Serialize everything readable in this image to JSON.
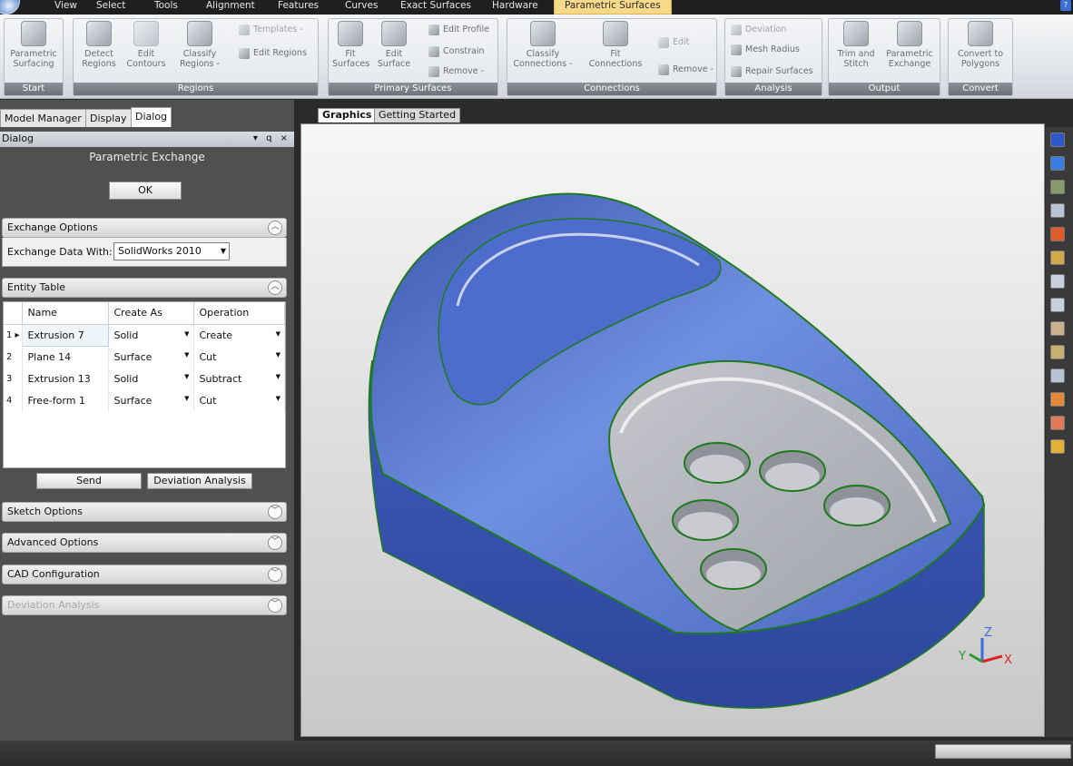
{
  "menubar": {
    "tabs": [
      "View",
      "Select",
      "Tools",
      "Alignment",
      "Features",
      "Curves",
      "Exact Surfaces",
      "Hardware",
      "Parametric Surfaces"
    ],
    "active_tab": "Parametric Surfaces"
  },
  "ribbon": {
    "groups": {
      "start": "Start",
      "regions": "Regions",
      "primary": "Primary Surfaces",
      "connections": "Connections",
      "analysis": "Analysis",
      "output": "Output",
      "convert": "Convert"
    },
    "buttons": {
      "parametric_surfacing": [
        "Parametric",
        "Surfacing"
      ],
      "detect_regions": [
        "Detect",
        "Regions"
      ],
      "edit_contours": [
        "Edit",
        "Contours"
      ],
      "classify_regions": [
        "Classify",
        "Regions -"
      ],
      "templates": "Templates -",
      "edit_regions": "Edit Regions",
      "fit_surfaces": [
        "Fit",
        "Surfaces"
      ],
      "edit_surface": [
        "Edit",
        "Surface"
      ],
      "edit_profile": "Edit Profile",
      "constrain": "Constrain",
      "remove_surf": "Remove -",
      "classify_connections": [
        "Classify",
        "Connections -"
      ],
      "fit_connections": [
        "Fit",
        "Connections"
      ],
      "edit_conn": "Edit",
      "remove_conn": "Remove -",
      "deviation": "Deviation",
      "mesh_radius": "Mesh Radius",
      "repair_surfaces": "Repair Surfaces",
      "trim_stitch": [
        "Trim and",
        "Stitch"
      ],
      "parametric_exchange": [
        "Parametric",
        "Exchange"
      ],
      "convert_polygons": [
        "Convert to",
        "Polygons"
      ]
    }
  },
  "panel": {
    "tabs": [
      "Model Manager",
      "Display",
      "Dialog"
    ],
    "active_tab": "Dialog",
    "header": "Dialog",
    "header_controls": "▾ q ×",
    "title": "Parametric Exchange",
    "ok": "OK",
    "exchange_options": {
      "title": "Exchange Options",
      "label": "Exchange Data With:",
      "value": "SolidWorks 2010"
    },
    "entity_table": {
      "title": "Entity Table",
      "columns": [
        "Name",
        "Create As",
        "Operation"
      ],
      "rows": [
        {
          "num": "1",
          "name": "Extrusion 7",
          "create_as": "Solid",
          "operation": "Create"
        },
        {
          "num": "2",
          "name": "Plane 14",
          "create_as": "Surface",
          "operation": "Cut"
        },
        {
          "num": "3",
          "name": "Extrusion 13",
          "create_as": "Solid",
          "operation": "Subtract"
        },
        {
          "num": "4",
          "name": "Free-form 1",
          "create_as": "Surface",
          "operation": "Cut"
        }
      ]
    },
    "send": "Send",
    "deviation_analysis_btn": "Deviation Analysis",
    "sections": [
      "Sketch Options",
      "Advanced Options",
      "CAD Configuration",
      "Deviation Analysis"
    ]
  },
  "graphics": {
    "tabs": [
      "Graphics",
      "Getting Started"
    ],
    "active_tab": "Graphics",
    "axis_labels": {
      "x": "X",
      "y": "Y",
      "z": "Z"
    }
  },
  "colors": {
    "model_blue": "#5a78cf",
    "edge_green": "#1e7a1e",
    "ribbon_active": "#f7d98a"
  },
  "toolbar_icons": [
    "view-cube-icon",
    "view-front-icon",
    "display-icon",
    "zoom-icon",
    "color-icon",
    "select-box-icon",
    "rotate-icon",
    "measure-icon",
    "brush-icon",
    "lasso-icon",
    "select-icon",
    "layer-icon",
    "layer2-icon",
    "render-icon"
  ]
}
